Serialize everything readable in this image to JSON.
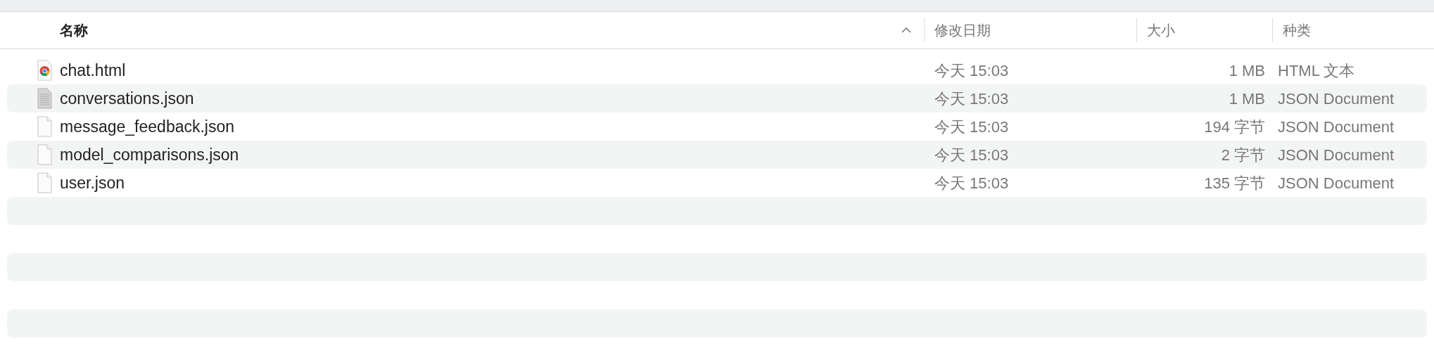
{
  "columns": [
    {
      "label": "名称",
      "sorted": true
    },
    {
      "label": "修改日期",
      "sorted": false
    },
    {
      "label": "大小",
      "sorted": false
    },
    {
      "label": "种类",
      "sorted": false
    }
  ],
  "files": [
    {
      "name": "chat.html",
      "kind": "browser",
      "modified": "今天 15:03",
      "size": "1 MB",
      "file_type": "HTML 文本"
    },
    {
      "name": "conversations.json",
      "kind": "text",
      "modified": "今天 15:03",
      "size": "1 MB",
      "file_type": "JSON Document"
    },
    {
      "name": "message_feedback.json",
      "kind": "blank",
      "modified": "今天 15:03",
      "size": "194 字节",
      "file_type": "JSON Document"
    },
    {
      "name": "model_comparisons.json",
      "kind": "blank",
      "modified": "今天 15:03",
      "size": "2 字节",
      "file_type": "JSON Document"
    },
    {
      "name": "user.json",
      "kind": "blank",
      "modified": "今天 15:03",
      "size": "135 字节",
      "file_type": "JSON Document"
    }
  ]
}
